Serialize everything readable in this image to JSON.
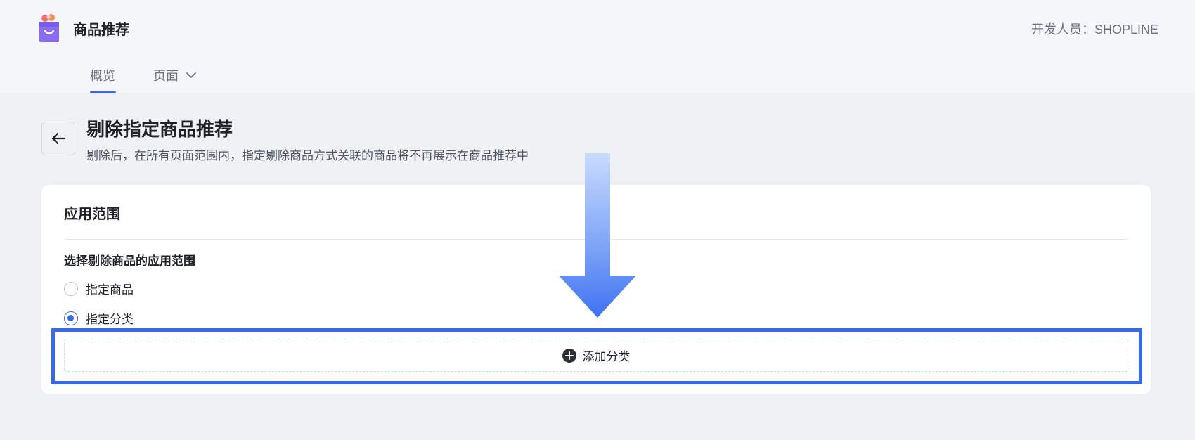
{
  "app": {
    "title": "商品推荐",
    "developer": "开发人员：SHOPLINE"
  },
  "tabs": [
    {
      "label": "概览",
      "active": true
    },
    {
      "label": "页面",
      "has_dropdown": true
    }
  ],
  "page": {
    "title": "剔除指定商品推荐",
    "description": "剔除后，在所有页面范围内，指定剔除商品方式关联的商品将不再展示在商品推荐中"
  },
  "card": {
    "title": "应用范围",
    "field_label": "选择剔除商品的应用范围",
    "options": [
      {
        "label": "指定商品",
        "selected": false
      },
      {
        "label": "指定分类",
        "selected": true
      }
    ],
    "add_button_label": "添加分类"
  },
  "icons": {
    "logo": "shopping-bag-logo-icon",
    "back": "arrow-left-icon",
    "dropdown": "chevron-down-icon",
    "add": "plus-circle-icon"
  },
  "colors": {
    "accent": "#356ae6",
    "annotation": "#356ae6"
  }
}
